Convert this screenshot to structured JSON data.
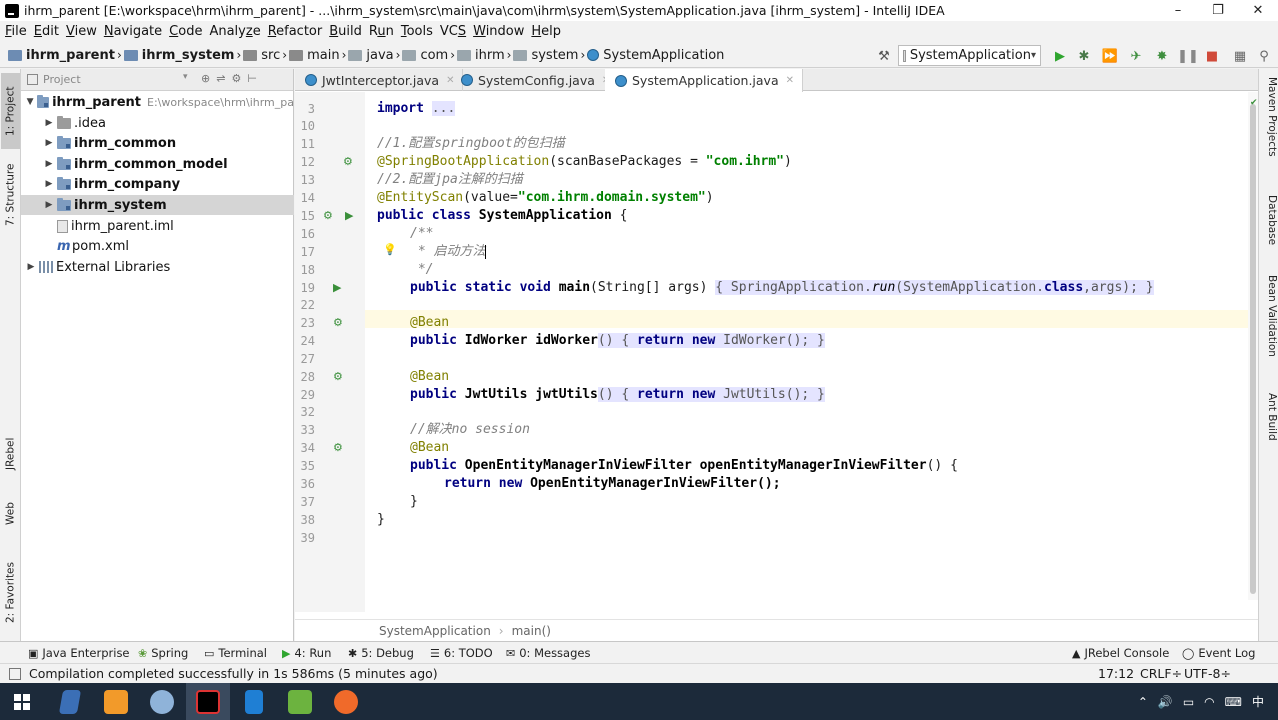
{
  "window": {
    "title": "ihrm_parent [E:\\workspace\\hrm\\ihrm_parent] - ...\\ihrm_system\\src\\main\\java\\com\\ihrm\\system\\SystemApplication.java [ihrm_system] - IntelliJ IDEA",
    "controls": [
      "–",
      "❐",
      "✕"
    ]
  },
  "menu": [
    {
      "mnemonic": "F",
      "rest": "ile"
    },
    {
      "mnemonic": "E",
      "rest": "dit"
    },
    {
      "mnemonic": "V",
      "rest": "iew"
    },
    {
      "mnemonic": "N",
      "rest": "avigate"
    },
    {
      "mnemonic": "C",
      "rest": "ode"
    },
    {
      "pre": "Analy",
      "mnemonic": "z",
      "rest": "e"
    },
    {
      "mnemonic": "R",
      "rest": "efactor"
    },
    {
      "mnemonic": "B",
      "rest": "uild"
    },
    {
      "pre": "R",
      "mnemonic": "u",
      "rest": "n"
    },
    {
      "mnemonic": "T",
      "rest": "ools"
    },
    {
      "pre": "VC",
      "mnemonic": "S",
      "rest": ""
    },
    {
      "mnemonic": "W",
      "rest": "indow"
    },
    {
      "mnemonic": "H",
      "rest": "elp"
    }
  ],
  "nav_breadcrumbs": [
    "ihrm_parent",
    "ihrm_system",
    "src",
    "main",
    "java",
    "com",
    "ihrm",
    "system",
    "SystemApplication"
  ],
  "run_config": {
    "label": "SystemApplication"
  },
  "left_strip": {
    "project": "1: Project",
    "structure": "7: Structure",
    "jrebel": "JRebel",
    "web": "Web",
    "favorites": "2: Favorites"
  },
  "right_strip": {
    "maven": "Maven Projects",
    "database": "Database",
    "bean": "Bean Validation",
    "ant": "Ant Build"
  },
  "project_panel": {
    "header": "Project",
    "tree": [
      {
        "name": "ihrm_parent",
        "path": "E:\\workspace\\hrm\\ihrm_pa",
        "bold": true,
        "expanded": true,
        "icon": "module-folder"
      },
      {
        "name": ".idea",
        "bold": false,
        "icon": "folder"
      },
      {
        "name": "ihrm_common",
        "bold": true,
        "icon": "module-folder"
      },
      {
        "name": "ihrm_common_model",
        "bold": true,
        "icon": "module-folder"
      },
      {
        "name": "ihrm_company",
        "bold": true,
        "icon": "module-folder"
      },
      {
        "name": "ihrm_system",
        "bold": true,
        "icon": "module-folder",
        "selected": true
      },
      {
        "name": "ihrm_parent.iml",
        "bold": false,
        "icon": "iml-file"
      },
      {
        "name": "pom.xml",
        "bold": false,
        "icon": "maven-file"
      },
      {
        "name": "External Libraries",
        "bold": false,
        "icon": "libraries"
      }
    ]
  },
  "editor_tabs": [
    {
      "label": "JwtInterceptor.java",
      "active": false
    },
    {
      "label": "SystemConfig.java",
      "active": false
    },
    {
      "label": "SystemApplication.java",
      "active": true
    }
  ],
  "code": {
    "line_numbers": [
      "3",
      "10",
      "11",
      "12",
      "13",
      "14",
      "15",
      "16",
      "17",
      "18",
      "19",
      "22",
      "23",
      "24",
      "27",
      "28",
      "29",
      "32",
      "33",
      "34",
      "35",
      "36",
      "37",
      "38",
      "39"
    ],
    "import_keyword": "import",
    "import_fold": "...",
    "comment1": "//1.配置springboot的包扫描",
    "ann1_name": "@SpringBootApplication",
    "ann1_args_pre": "(scanBasePackages = ",
    "ann1_str": "\"com.ihrm\"",
    "ann1_args_post": ")",
    "comment2": "//2.配置jpa注解的扫描",
    "ann2_name": "@EntityScan",
    "ann2_args_pre": "(value=",
    "ann2_str": "\"com.ihrm.domain.system\"",
    "ann2_args_post": ")",
    "class_decl_kw": "public class",
    "class_name": "SystemApplication",
    "brace_open": "{",
    "doc_open": "/**",
    "doc_line": " * 启动方法",
    "doc_close": " */",
    "main_kw": "public static void",
    "main_name": "main",
    "main_params": "(String[] args)",
    "main_body_pre": "{ SpringApplication.",
    "main_run": "run",
    "main_body_post": "(SystemApplication.",
    "main_class_kw": "class",
    "main_tail": ",args); }",
    "bean": "@Bean",
    "idw_kw": "public",
    "idw_type": "IdWorker",
    "idw_name": "idWorker",
    "idw_body_pre": "() { ",
    "return_kw": "return",
    "new_kw": "new",
    "idw_tail": "IdWorker(); }",
    "jwt_type": "JwtUtils",
    "jwt_name": "jwtUtils",
    "jwt_tail": "JwtUtils(); }",
    "comment3": "//解决no session",
    "oem_type": "OpenEntityManagerInViewFilter",
    "oem_name": "openEntityManagerInViewFilter",
    "oem_sig_tail": "() {",
    "oem_return_tail": "OpenEntityManagerInViewFilter();",
    "close_inner": "}",
    "close_outer": "}"
  },
  "editor_breadcrumb": [
    "SystemApplication",
    "main()"
  ],
  "tool_windows": [
    {
      "label": "Java Enterprise",
      "icon": "java-enterprise-icon"
    },
    {
      "label": "Spring",
      "icon": "spring-icon"
    },
    {
      "label": "Terminal",
      "icon": "terminal-icon"
    },
    {
      "label": "4: Run",
      "icon": "run-icon"
    },
    {
      "label": "5: Debug",
      "icon": "debug-icon"
    },
    {
      "label": "6: TODO",
      "icon": "todo-icon"
    },
    {
      "label": "0: Messages",
      "icon": "messages-icon"
    },
    {
      "label": "JRebel Console",
      "icon": "jrebel-icon"
    },
    {
      "label": "Event Log",
      "icon": "event-log-icon"
    }
  ],
  "status": {
    "message": "Compilation completed successfully in 1s 586ms (5 minutes ago)",
    "position": "17:12",
    "line_sep": "CRLF÷",
    "encoding": "UTF-8÷"
  },
  "colors": {
    "keyword": "#000080",
    "annotation": "#808000",
    "string": "#008000",
    "comment": "#808080",
    "taskbar": "#1c2a3a"
  }
}
